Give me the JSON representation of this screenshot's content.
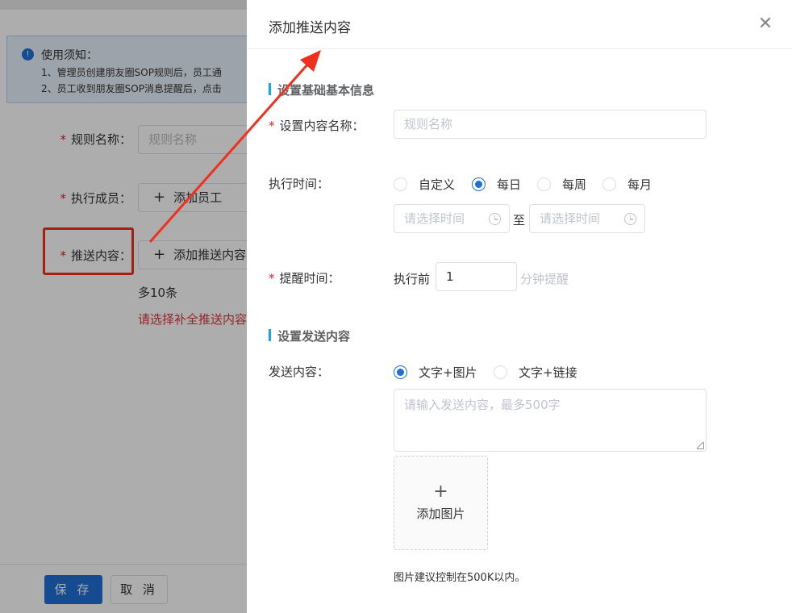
{
  "background": {
    "notice": {
      "title": "使用须知：",
      "line1": "1、管理员创建朋友圈SOP规则后，员工通",
      "line2": "2、员工收到朋友圈SOP消息提醒后，点击"
    },
    "rule_name_label": "规则名称：",
    "rule_name_placeholder": "规则名称",
    "members_label": "执行成员：",
    "add_member_button": "添加员工",
    "push_content_label": "推送内容：",
    "add_push_content_button": "添加推送内容",
    "hint": "多10条",
    "error": "请选择补全推送内容",
    "save_button": "保 存",
    "cancel_button": "取 消"
  },
  "drawer": {
    "title": "添加推送内容",
    "close_icon": "✕",
    "section_basic": "设置基础基本信息",
    "content_name_label": "设置内容名称：",
    "content_name_placeholder": "规则名称",
    "exec_time_label": "执行时间：",
    "exec_time_options": [
      "自定义",
      "每日",
      "每周",
      "每月"
    ],
    "exec_time_selected": "每日",
    "start_time_placeholder": "请选择时间",
    "range_separator": "至",
    "end_time_placeholder": "请选择时间",
    "remind_label": "提醒时间：",
    "remind_prefix": "执行前",
    "remind_value": "1",
    "remind_suffix": "分钟提醒",
    "section_send": "设置发送内容",
    "send_content_label": "发送内容：",
    "send_type_options": [
      "文字+图片",
      "文字+链接"
    ],
    "send_type_selected": "文字+图片",
    "send_content_placeholder": "请输入发送内容，最多500字",
    "add_image_label": "添加图片",
    "image_tip": "图片建议控制在500K以内。"
  },
  "colors": {
    "primary": "#1f6fd6",
    "annotation_red": "#f0301e",
    "accent_bar": "#1fa3e8"
  }
}
